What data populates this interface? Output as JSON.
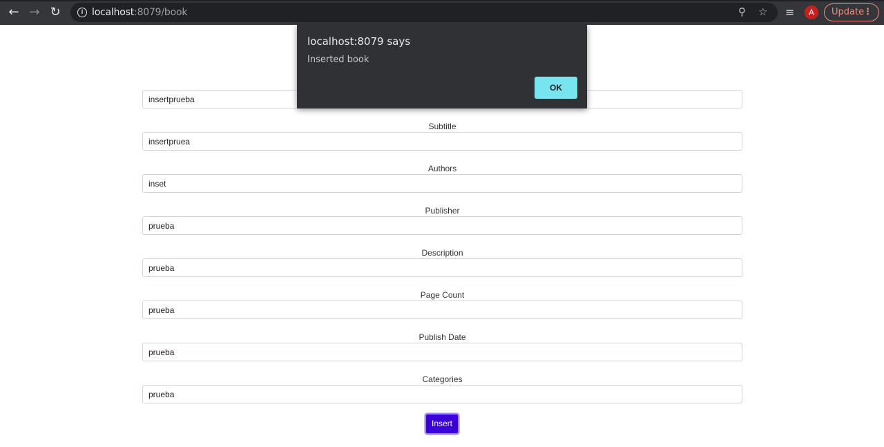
{
  "browser": {
    "url_host": "localhost",
    "url_rest": ":8079/book",
    "avatar_letter": "A",
    "update_label": "Update"
  },
  "form": {
    "fields": [
      {
        "label": "",
        "value": "insertprueba"
      },
      {
        "label": "Subtitle",
        "value": "insertpruea"
      },
      {
        "label": "Authors",
        "value": "inset"
      },
      {
        "label": "Publisher",
        "value": "prueba"
      },
      {
        "label": "Description",
        "value": "prueba"
      },
      {
        "label": "Page Count",
        "value": "prueba"
      },
      {
        "label": "Publish Date",
        "value": "prueba"
      },
      {
        "label": "Categories",
        "value": "prueba"
      }
    ],
    "submit_label": "Insert"
  },
  "dialog": {
    "title": "localhost:8079 says",
    "message": "Inserted book",
    "ok_label": "OK"
  },
  "colors": {
    "submit_bg": "#3a00d6",
    "ok_bg": "#78e4f0",
    "update_accent": "#f28b82"
  }
}
